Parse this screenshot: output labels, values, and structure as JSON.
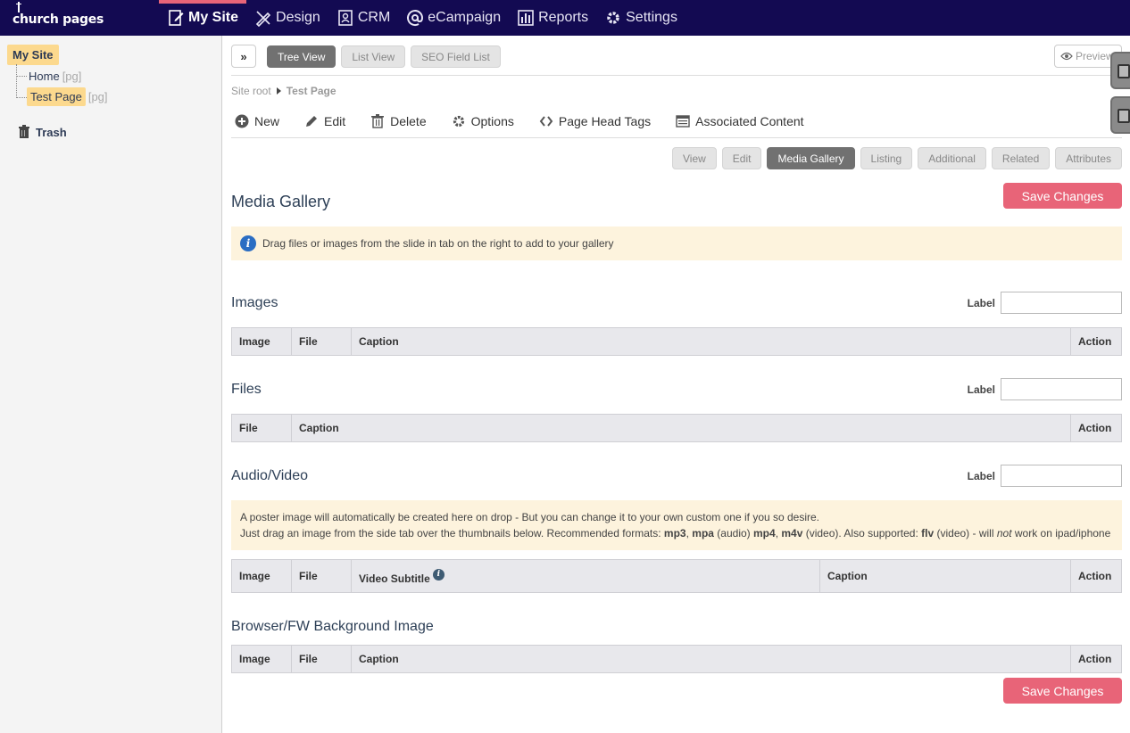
{
  "app": {
    "logo": "church pages"
  },
  "nav": [
    {
      "label": "My Site",
      "icon": "page-edit-icon",
      "active": true
    },
    {
      "label": "Design",
      "icon": "pencil-ruler-icon",
      "active": false
    },
    {
      "label": "CRM",
      "icon": "address-book-icon",
      "active": false
    },
    {
      "label": "eCampaign",
      "icon": "at-sign-icon",
      "active": false
    },
    {
      "label": "Reports",
      "icon": "bar-chart-icon",
      "active": false
    },
    {
      "label": "Settings",
      "icon": "gear-icon",
      "active": false
    }
  ],
  "sidebar": {
    "root": "My Site",
    "nodes": [
      {
        "label": "Home",
        "tag": "[pg]"
      },
      {
        "label": "Test Page",
        "tag": "[pg]"
      }
    ],
    "trash": "Trash"
  },
  "viewtabs": [
    {
      "label": "Tree View",
      "active": true
    },
    {
      "label": "List View",
      "active": false
    },
    {
      "label": "SEO Field List",
      "active": false
    }
  ],
  "preview": "Preview",
  "breadcrumb": {
    "root": "Site root",
    "current": "Test Page"
  },
  "toolbar": [
    {
      "label": "New",
      "icon": "plus-circle-icon"
    },
    {
      "label": "Edit",
      "icon": "pencil-icon"
    },
    {
      "label": "Delete",
      "icon": "trash-icon"
    },
    {
      "label": "Options",
      "icon": "gear-icon"
    },
    {
      "label": "Page Head Tags",
      "icon": "code-brackets-icon"
    },
    {
      "label": "Associated Content",
      "icon": "content-list-icon"
    }
  ],
  "subtabs": [
    {
      "label": "View",
      "active": false
    },
    {
      "label": "Edit",
      "active": false
    },
    {
      "label": "Media Gallery",
      "active": true
    },
    {
      "label": "Listing",
      "active": false
    },
    {
      "label": "Additional",
      "active": false
    },
    {
      "label": "Related",
      "active": false
    },
    {
      "label": "Attributes",
      "active": false
    }
  ],
  "page_title": "Media Gallery",
  "save_label": "Save Changes",
  "info_text": "Drag files or images from the slide in tab on the right to add to your gallery",
  "label_text": "Label",
  "images": {
    "title": "Images",
    "cols": [
      "Image",
      "File",
      "Caption",
      "Action"
    ]
  },
  "files": {
    "title": "Files",
    "cols": [
      "File",
      "Caption",
      "Action"
    ]
  },
  "av": {
    "title": "Audio/Video",
    "note1": "A poster image will automatically be created here on drop - But you can change it to your own custom one if you so desire.",
    "note2": {
      "t1": "Just drag an image from the side tab over the thumbnails below. Recommended formats: ",
      "b1": "mp3",
      "t2": ", ",
      "b2": "mpa",
      "t3": " (audio) ",
      "b3": "mp4",
      "t4": ", ",
      "b4": "m4v",
      "t5": " (video). Also supported: ",
      "b5": "flv",
      "t6": " (video) - will ",
      "i1": "not",
      "t7": " work on ipad/iphone"
    },
    "cols": [
      "Image",
      "File",
      "Video Subtitle",
      "Caption",
      "Action"
    ]
  },
  "bg": {
    "title": "Browser/FW Background Image",
    "cols": [
      "Image",
      "File",
      "Caption",
      "Action"
    ]
  }
}
